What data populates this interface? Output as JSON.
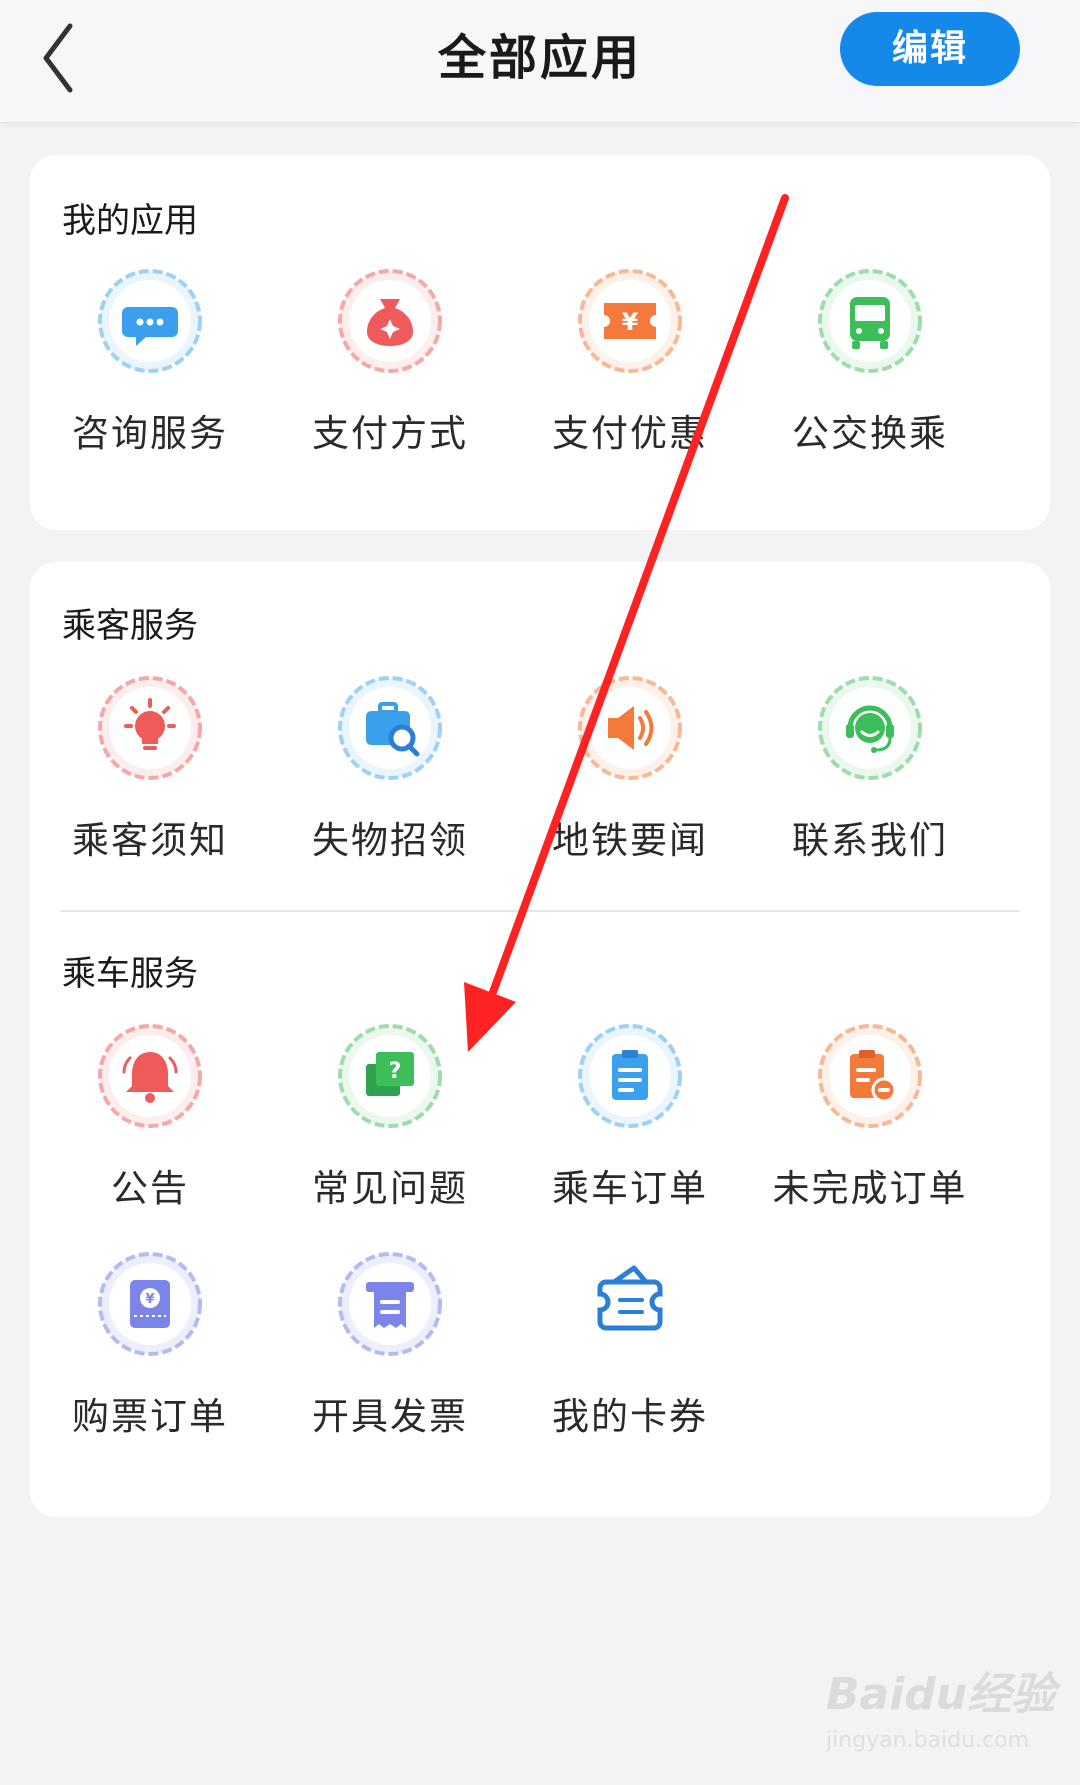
{
  "header": {
    "title": "全部应用",
    "edit_label": "编辑"
  },
  "my_apps": {
    "title": "我的应用",
    "items": [
      {
        "label": "咨询服务",
        "icon": "chat-bubble-icon",
        "color": "#3aa0ee"
      },
      {
        "label": "支付方式",
        "icon": "money-bag-icon",
        "color": "#ef5a5a"
      },
      {
        "label": "支付优惠",
        "icon": "yuan-ticket-icon",
        "color": "#f47a3c"
      },
      {
        "label": "公交换乘",
        "icon": "bus-icon",
        "color": "#3cbf5a"
      }
    ]
  },
  "passenger_services": {
    "title": "乘客服务",
    "items": [
      {
        "label": "乘客须知",
        "icon": "lightbulb-icon",
        "color": "#ef5a5a"
      },
      {
        "label": "失物招领",
        "icon": "briefcase-search-icon",
        "color": "#3aa0ee"
      },
      {
        "label": "地铁要闻",
        "icon": "speaker-icon",
        "color": "#f47a3c"
      },
      {
        "label": "联系我们",
        "icon": "headset-agent-icon",
        "color": "#3cbf5a"
      }
    ]
  },
  "riding_services": {
    "title": "乘车服务",
    "items": [
      {
        "label": "公告",
        "icon": "bell-icon",
        "color": "#ef5a5a"
      },
      {
        "label": "常见问题",
        "icon": "question-cards-icon",
        "color": "#3cbf5a"
      },
      {
        "label": "乘车订单",
        "icon": "clipboard-icon",
        "color": "#3aa0ee"
      },
      {
        "label": "未完成订单",
        "icon": "clipboard-minus-icon",
        "color": "#f47a3c"
      },
      {
        "label": "购票订单",
        "icon": "yuan-ticket-stub-icon",
        "color": "#7b84e8"
      },
      {
        "label": "开具发票",
        "icon": "invoice-icon",
        "color": "#7b84e8"
      },
      {
        "label": "我的卡券",
        "icon": "card-coupon-icon",
        "color": "#2b7fd6"
      }
    ]
  },
  "watermark": {
    "logo": "Baidu经验",
    "url": "jingyan.baidu.com"
  }
}
